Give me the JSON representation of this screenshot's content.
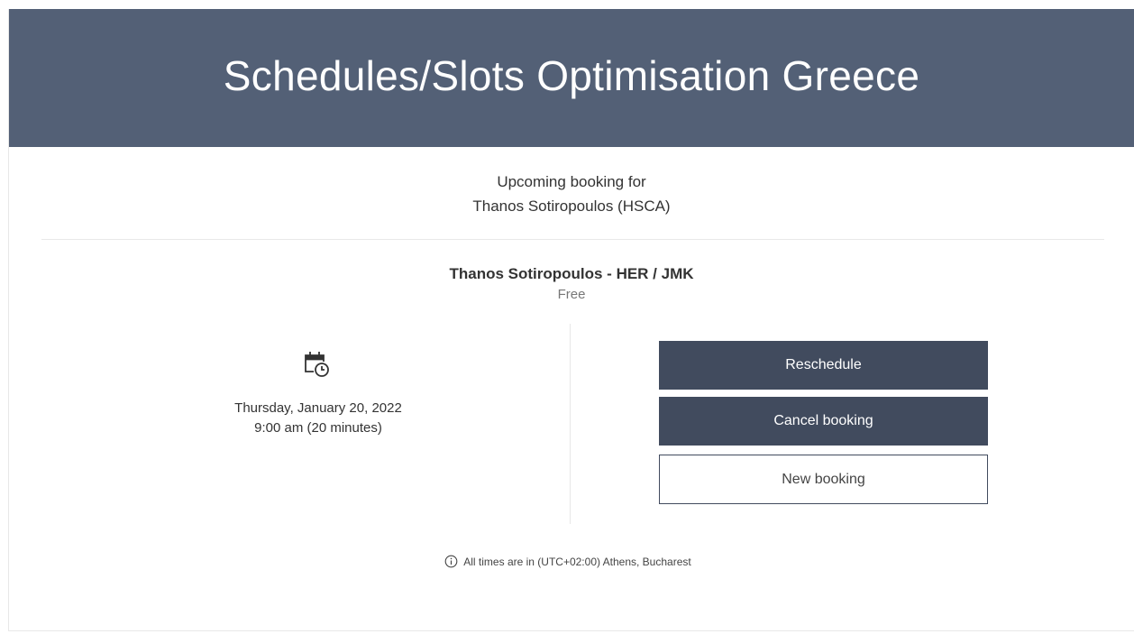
{
  "header": {
    "title": "Schedules/Slots Optimisation Greece"
  },
  "booking_header": {
    "line1": "Upcoming booking for",
    "line2": "Thanos Sotiropoulos (HSCA)"
  },
  "service": {
    "name": "Thanos Sotiropoulos - HER / JMK",
    "price": "Free"
  },
  "appointment": {
    "icon": "calendar-clock-icon",
    "date": "Thursday, January 20, 2022",
    "time": "9:00 am (20 minutes)"
  },
  "actions": {
    "reschedule_label": "Reschedule",
    "cancel_label": "Cancel booking",
    "new_label": "New booking"
  },
  "timezone": {
    "icon": "info-icon",
    "text": "All times are in (UTC+02:00) Athens, Bucharest"
  },
  "colors": {
    "header_bg": "#536076",
    "button_dark": "#414b5e"
  }
}
